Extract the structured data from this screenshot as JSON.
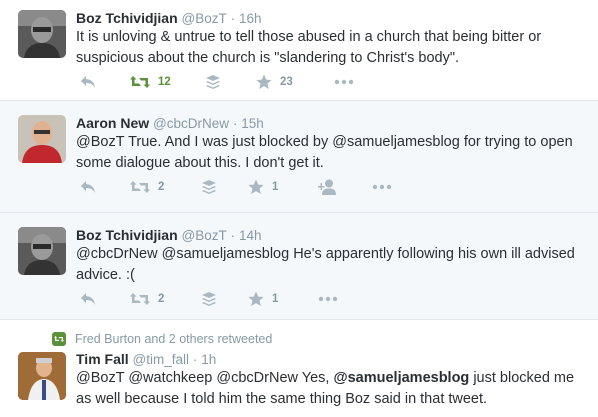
{
  "tweets": [
    {
      "name": "Boz Tchividjian",
      "handle": "@BozT",
      "dot": "·",
      "time": "16h",
      "text": "It is unloving & untrue to tell those abused in a church that being bitter or suspicious about the church is \"slandering to Christ's body\".",
      "retweets": "12",
      "favorites": "23",
      "retweeted": true
    },
    {
      "name": "Aaron New",
      "handle": "@cbcDrNew",
      "dot": "·",
      "time": "15h",
      "text": "@BozT True. And I was just blocked by @samueljamesblog for trying to open some dialogue about this. I don't get it.",
      "retweets": "2",
      "favorites": "1"
    },
    {
      "name": "Boz Tchividjian",
      "handle": "@BozT",
      "dot": "·",
      "time": "14h",
      "text": "@cbcDrNew @samueljamesblog He's apparently following his own ill advised advice. :(",
      "retweets": "2",
      "favorites": "1"
    },
    {
      "retweet_context": "Fred Burton and 2 others retweeted",
      "name": "Tim Fall",
      "handle": "@tim_fall",
      "dot": "·",
      "time": "1h",
      "text_before": "@BozT @watchkeep @cbcDrNew Yes, ",
      "text_bold": "@samueljamesblog",
      "text_after": " just blocked me as well because I told him the same thing Boz said in that tweet."
    }
  ],
  "icons": [
    "reply-icon",
    "retweet-icon",
    "stack-icon",
    "star-icon",
    "follow-icon",
    "more-icon"
  ],
  "colors": {
    "text": "#292f33",
    "muted": "#8899a6",
    "retweet_green": "#5c913b",
    "border": "#e1e8ed"
  }
}
